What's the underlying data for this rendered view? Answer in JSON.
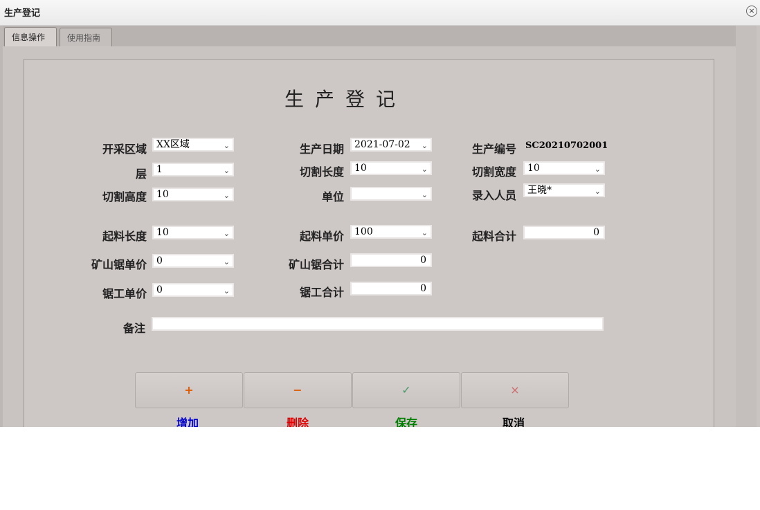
{
  "window": {
    "title": "生产登记",
    "close_icon": "×"
  },
  "tabs": [
    {
      "label": "信息操作",
      "active": true
    },
    {
      "label": "使用指南",
      "active": false
    }
  ],
  "form": {
    "heading": "生产登记",
    "fields": {
      "mining_area": {
        "label": "开采区域",
        "value": "XX区域"
      },
      "production_date": {
        "label": "生产日期",
        "value": "2021-07-02"
      },
      "production_no": {
        "label": "生产编号",
        "value": "SC20210702001"
      },
      "layer": {
        "label": "层",
        "value": "1"
      },
      "cut_length": {
        "label": "切割长度",
        "value": "10"
      },
      "cut_width": {
        "label": "切割宽度",
        "value": "10"
      },
      "cut_height": {
        "label": "切割高度",
        "value": "10"
      },
      "unit": {
        "label": "单位",
        "value": ""
      },
      "entry_person": {
        "label": "录入人员",
        "value": "王晓*"
      },
      "lift_length": {
        "label": "起料长度",
        "value": "10"
      },
      "lift_price": {
        "label": "起料单价",
        "value": "100"
      },
      "lift_total": {
        "label": "起料合计",
        "value": "0"
      },
      "mine_saw_price": {
        "label": "矿山锯单价",
        "value": "0"
      },
      "mine_saw_total": {
        "label": "矿山锯合计",
        "value": "0"
      },
      "saw_price": {
        "label": "锯工单价",
        "value": "0"
      },
      "saw_total": {
        "label": "锯工合计",
        "value": "0"
      },
      "remark": {
        "label": "备注",
        "value": ""
      }
    }
  },
  "actions": {
    "add": {
      "symbol": "+",
      "label": "增加",
      "color": "#0000cc",
      "symbol_color": "#e05a00"
    },
    "delete": {
      "symbol": "−",
      "label": "删除",
      "color": "#e00000",
      "symbol_color": "#e05a00"
    },
    "save": {
      "symbol": "✓",
      "label": "保存",
      "color": "#008000",
      "symbol_color": "#4a9a6a"
    },
    "cancel": {
      "symbol": "×",
      "label": "取消",
      "color": "#000000",
      "symbol_color": "#cc6a6a"
    }
  },
  "chevron": "⌄"
}
